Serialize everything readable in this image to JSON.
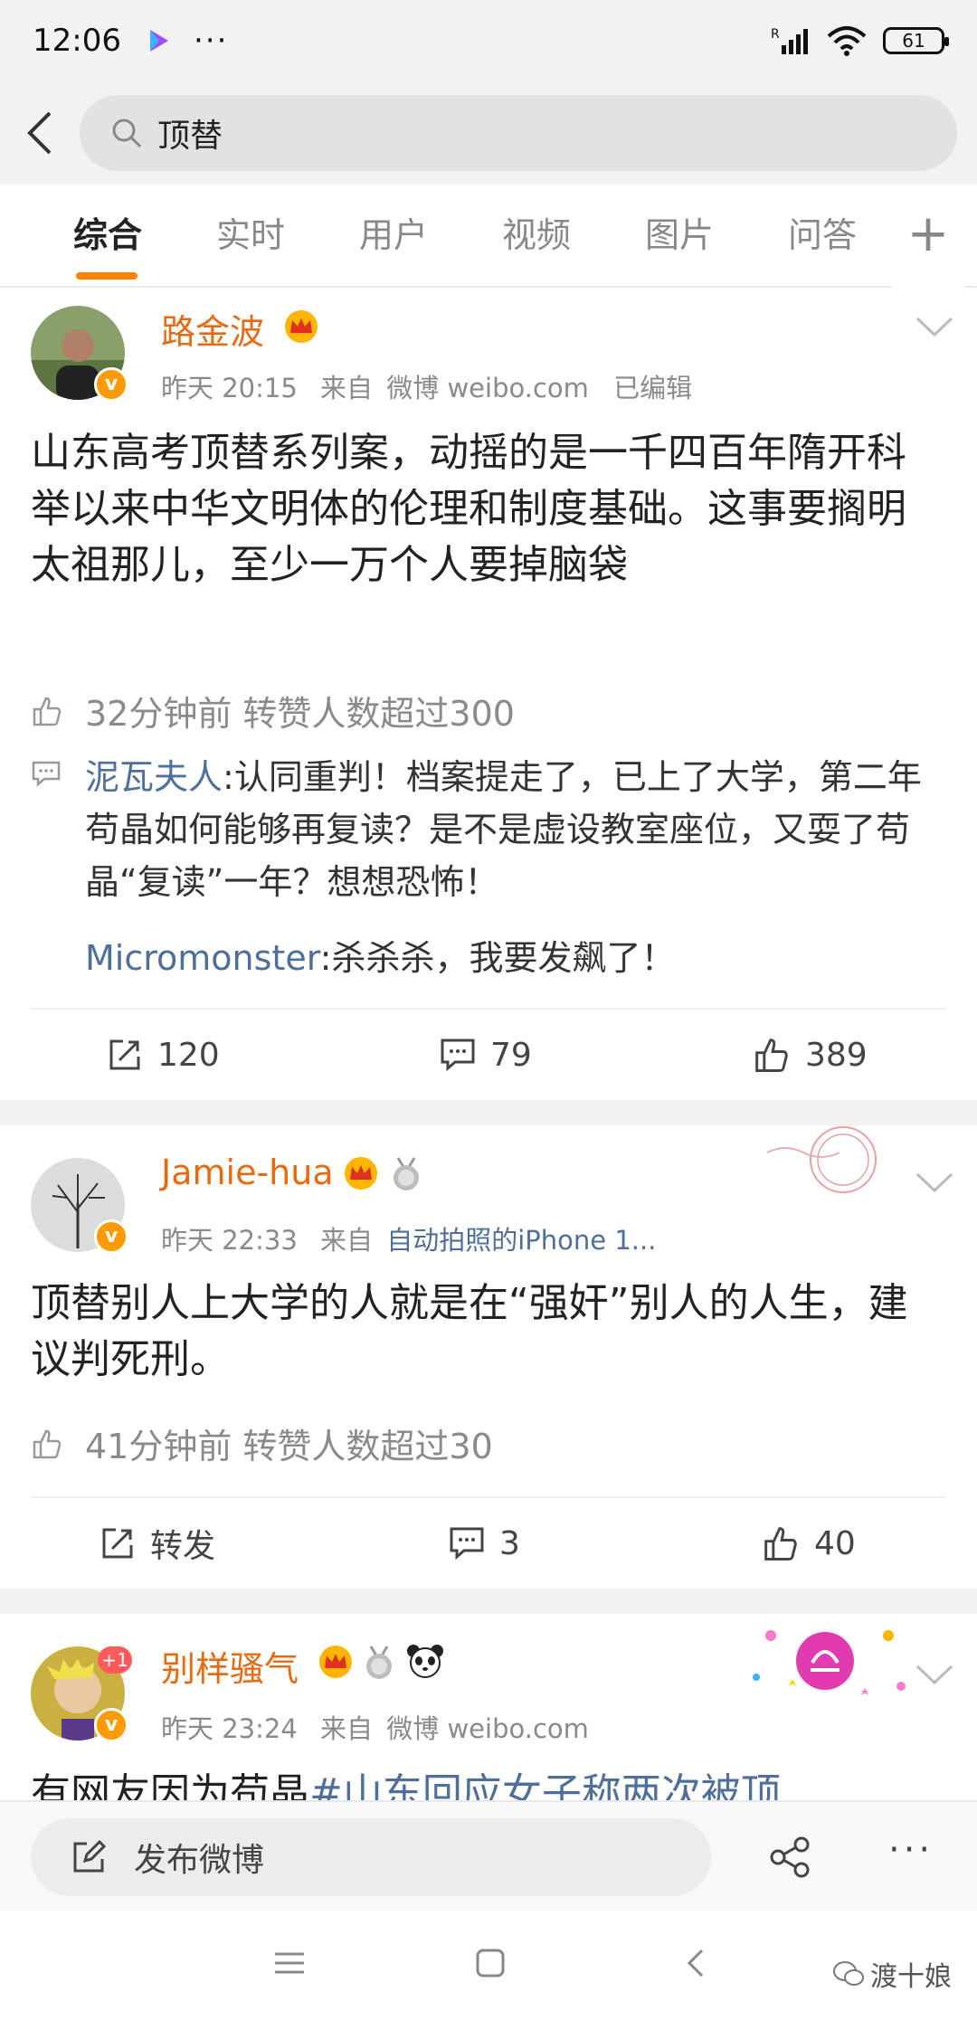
{
  "status_bar": {
    "time": "12:06",
    "dots": "···",
    "battery": "61"
  },
  "search": {
    "query": "顶替"
  },
  "tabs": [
    {
      "label": "综合"
    },
    {
      "label": "实时"
    },
    {
      "label": "用户"
    },
    {
      "label": "视频"
    },
    {
      "label": "图片"
    },
    {
      "label": "问答"
    }
  ],
  "tab_plus": "+",
  "posts": [
    {
      "username": "路金波",
      "time": "昨天 20:15",
      "source_prefix": "来自",
      "source": "微博 weibo.com",
      "edited": "已编辑",
      "text": "山东高考顶替系列案，动摇的是一千四百年隋开科举以来中华文明体的伦理和制度基础。这事要搁明太祖那儿，至少一万个人要掉脑袋",
      "hot": "32分钟前  转赞人数超过300",
      "comments": [
        {
          "author": "泥瓦夫人",
          "text": ":认同重判！档案提走了，已上了大学，第二年苟晶如何能够再复读？是不是虚设教室座位，又耍了苟晶“复读”一年？想想恐怖！"
        },
        {
          "author": "Micromonster",
          "text": ":杀杀杀，我要发飙了！"
        }
      ],
      "reposts": "120",
      "comments_count": "79",
      "likes": "389"
    },
    {
      "username": "Jamie-hua",
      "time": "昨天 22:33",
      "source_prefix": "来自",
      "source": "自动拍照的iPhone 1...",
      "text": "顶替别人上大学的人就是在“强奸”别人的人生，建议判死刑。",
      "hot": "41分钟前  转赞人数超过30",
      "reposts": "转发",
      "comments_count": "3",
      "likes": "40"
    },
    {
      "username": "别样骚气",
      "time": "昨天 23:24",
      "source_prefix": "来自",
      "source": "微博 weibo.com",
      "text_prefix": "有网友因为苟晶",
      "hashtag": "#山东回应女子称两次被顶"
    }
  ],
  "compose": {
    "label": "发布微博"
  },
  "more": "···",
  "watermark": "渡十娘",
  "colors": {
    "accent": "#ff8200",
    "username": "#e86a10",
    "link": "#4e6f9c",
    "verified": "#ff9b00"
  }
}
